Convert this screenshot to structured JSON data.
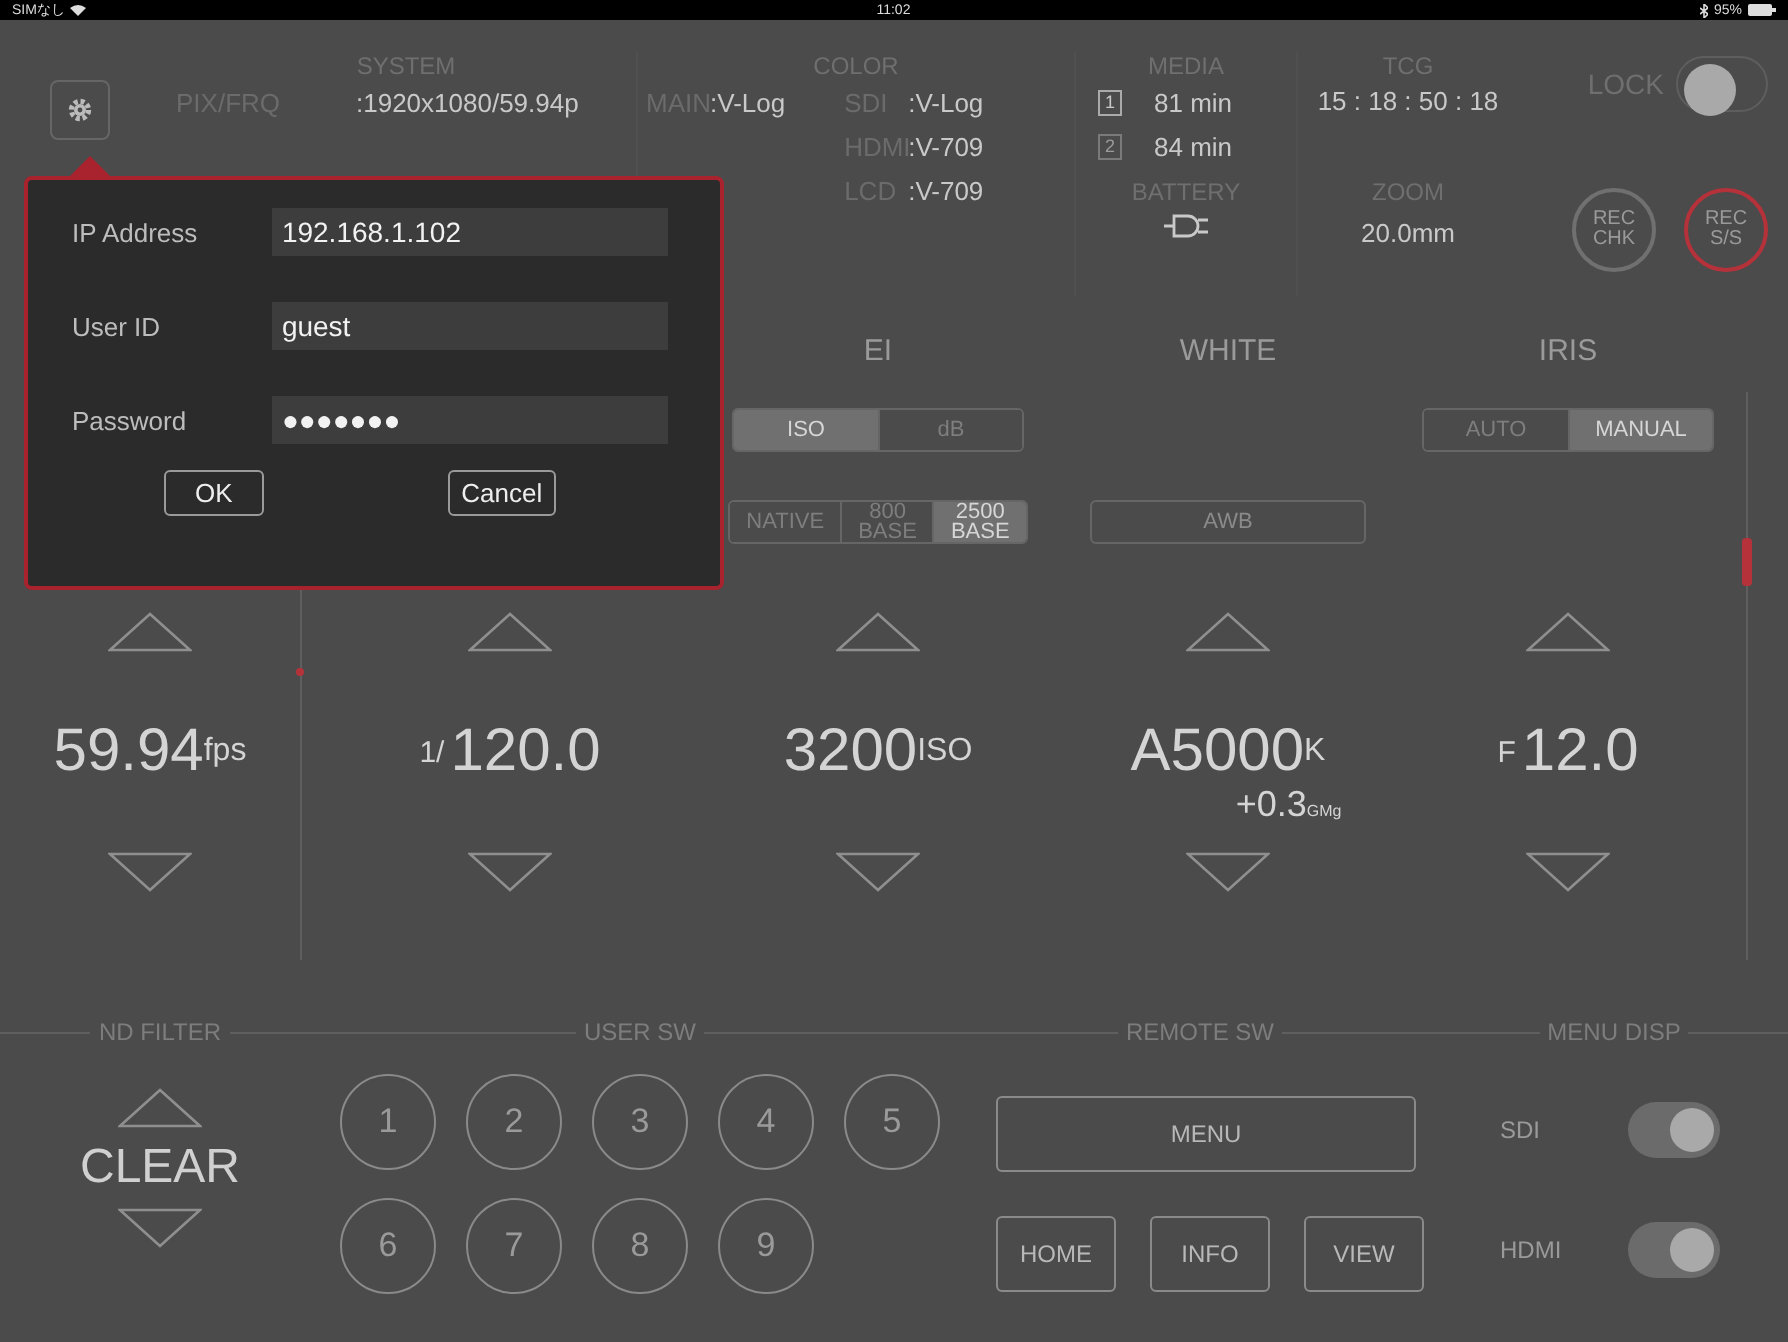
{
  "status_bar": {
    "carrier": "SIMなし",
    "time": "11:02",
    "battery": "95%"
  },
  "header": {
    "system": {
      "title": "SYSTEM",
      "rows": [
        {
          "label": "PIX/FRQ",
          "value": ":1920x1080/59.94p"
        }
      ]
    },
    "color": {
      "title": "COLOR",
      "main": [
        {
          "label": "MAIN",
          "value": ":V-Log"
        }
      ],
      "outputs": [
        {
          "label": "SDI",
          "value": ":V-Log"
        },
        {
          "label": "HDMI",
          "value": ":V-709"
        },
        {
          "label": "LCD",
          "value": ":V-709"
        }
      ]
    },
    "media": {
      "title": "MEDIA",
      "slots": [
        {
          "slot": "1",
          "value": "81 min",
          "active": true
        },
        {
          "slot": "2",
          "value": "84 min",
          "active": false
        }
      ]
    },
    "battery": {
      "title": "BATTERY"
    },
    "tcg": {
      "title": "TCG",
      "value": "15 : 18 : 50 : 18"
    },
    "zoom": {
      "title": "ZOOM",
      "value": "20.0mm"
    },
    "lock": {
      "label": "LOCK",
      "on": false
    },
    "rec_buttons": [
      {
        "label": "REC\nCHK",
        "kind": "check"
      },
      {
        "label": "REC\nS/S",
        "kind": "record"
      }
    ]
  },
  "controls": [
    {
      "value": "59.94",
      "unit": "fps"
    },
    {
      "prefix": "1/",
      "value": "120.0"
    },
    {
      "title": "EI",
      "value": "3200",
      "unit": "ISO",
      "groups": [
        [
          {
            "label": "ISO",
            "selected": true
          },
          {
            "label": "dB",
            "selected": false
          }
        ],
        [
          {
            "label": "NATIVE",
            "selected": false
          },
          {
            "label": "800\nBASE",
            "selected": false
          },
          {
            "label": "2500\nBASE",
            "selected": true
          }
        ]
      ]
    },
    {
      "title": "WHITE",
      "value": "A5000",
      "unit": "K",
      "sub": "+0.3",
      "sub_unit": "GMg",
      "buttons": [
        "AWB"
      ]
    },
    {
      "title": "IRIS",
      "prefix": "F",
      "value": "12.0",
      "groups": [
        [
          {
            "label": "AUTO",
            "selected": false
          },
          {
            "label": "MANUAL",
            "selected": true
          }
        ]
      ]
    }
  ],
  "iris_slider": {
    "level": 0.3
  },
  "bottom": {
    "nd_filter": {
      "title": "ND FILTER",
      "value": "CLEAR"
    },
    "user_sw": {
      "title": "USER SW",
      "buttons": [
        "1",
        "2",
        "3",
        "4",
        "5",
        "6",
        "7",
        "8",
        "9"
      ]
    },
    "remote_sw": {
      "title": "REMOTE SW",
      "menu": "MENU",
      "buttons": [
        "HOME",
        "INFO",
        "VIEW"
      ]
    },
    "menu_disp": {
      "title": "MENU DISP",
      "toggles": [
        {
          "label": "SDI",
          "on": true
        },
        {
          "label": "HDMI",
          "on": true
        }
      ]
    }
  },
  "popup": {
    "fields": [
      {
        "label": "IP Address",
        "value": "192.168.1.102"
      },
      {
        "label": "User ID",
        "value": "guest"
      },
      {
        "label": "Password",
        "value": "●●●●●●●"
      }
    ],
    "buttons": [
      "OK",
      "Cancel"
    ]
  }
}
